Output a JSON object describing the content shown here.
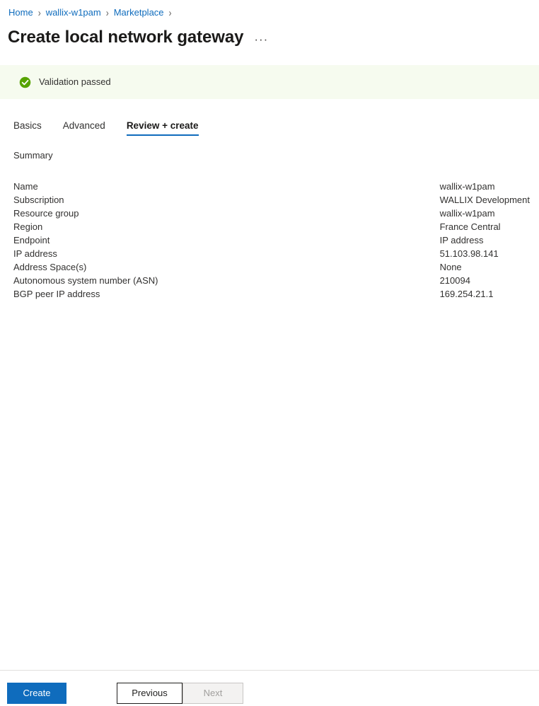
{
  "breadcrumb": {
    "separator": "›",
    "items": [
      {
        "label": "Home"
      },
      {
        "label": "wallix-w1pam"
      },
      {
        "label": "Marketplace"
      }
    ]
  },
  "header": {
    "title": "Create local network gateway",
    "more_label": "···"
  },
  "banner": {
    "text": "Validation passed",
    "icon": "check-circle-icon",
    "background": "#f6fbef",
    "icon_color": "#57a300"
  },
  "tabs": [
    {
      "label": "Basics",
      "active": false
    },
    {
      "label": "Advanced",
      "active": false
    },
    {
      "label": "Review + create",
      "active": true
    }
  ],
  "summary": {
    "heading": "Summary",
    "rows": [
      {
        "label": "Name",
        "value": "wallix-w1pam"
      },
      {
        "label": "Subscription",
        "value": "WALLIX Development"
      },
      {
        "label": "Resource group",
        "value": "wallix-w1pam"
      },
      {
        "label": "Region",
        "value": "France Central"
      },
      {
        "label": "Endpoint",
        "value": "IP address"
      },
      {
        "label": "IP address",
        "value": "51.103.98.141"
      },
      {
        "label": "Address Space(s)",
        "value": "None"
      },
      {
        "label": "Autonomous system number (ASN)",
        "value": "210094"
      },
      {
        "label": "BGP peer IP address",
        "value": "169.254.21.1"
      }
    ]
  },
  "footer": {
    "create_label": "Create",
    "previous_label": "Previous",
    "next_label": "Next",
    "accent_color": "#0f6cbd"
  }
}
